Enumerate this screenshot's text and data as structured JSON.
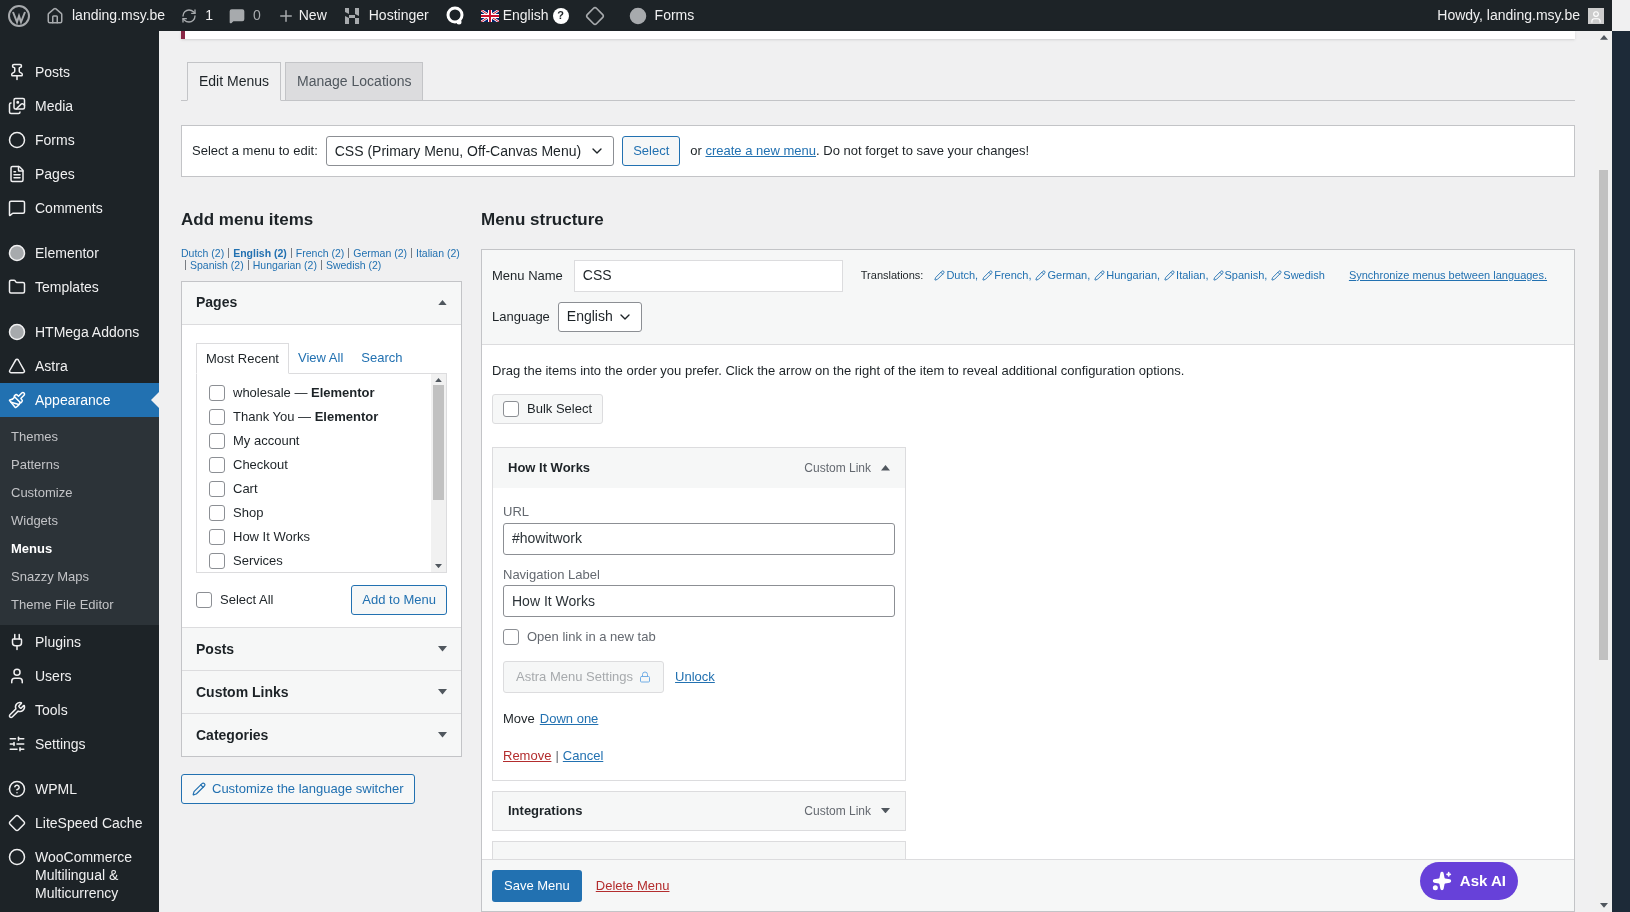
{
  "admin_bar": {
    "site": "landing.msy.be",
    "updates": "1",
    "comments": "0",
    "new": "New",
    "hostinger": "Hostinger",
    "language": "English",
    "language_help": "?",
    "forms": "Forms",
    "howdy": "Howdy, landing.msy.be"
  },
  "sidebar": {
    "items": [
      {
        "kind": "item",
        "label": "Posts",
        "selected": false
      },
      {
        "kind": "item",
        "label": "Media",
        "selected": false
      },
      {
        "kind": "item",
        "label": "Forms",
        "selected": false
      },
      {
        "kind": "item",
        "label": "Pages",
        "selected": false
      },
      {
        "kind": "item",
        "label": "Comments",
        "selected": false
      },
      {
        "kind": "separator"
      },
      {
        "kind": "item",
        "label": "Elementor",
        "selected": false
      },
      {
        "kind": "item",
        "label": "Templates",
        "selected": false
      },
      {
        "kind": "separator"
      },
      {
        "kind": "item",
        "label": "HTMega Addons",
        "selected": false
      },
      {
        "kind": "item",
        "label": "Astra",
        "selected": false
      },
      {
        "kind": "item",
        "label": "Appearance",
        "selected": true,
        "children": [
          {
            "label": "Themes",
            "selected": false
          },
          {
            "label": "Patterns",
            "selected": false
          },
          {
            "label": "Customize",
            "selected": false
          },
          {
            "label": "Widgets",
            "selected": false
          },
          {
            "label": "Menus",
            "selected": true
          },
          {
            "label": "Snazzy Maps",
            "selected": false
          },
          {
            "label": "Theme File Editor",
            "selected": false
          }
        ]
      },
      {
        "kind": "item",
        "label": "Plugins",
        "selected": false
      },
      {
        "kind": "item",
        "label": "Users",
        "selected": false
      },
      {
        "kind": "item",
        "label": "Tools",
        "selected": false
      },
      {
        "kind": "item",
        "label": "Settings",
        "selected": false
      },
      {
        "kind": "separator"
      },
      {
        "kind": "item",
        "label": "WPML",
        "selected": false
      },
      {
        "kind": "item",
        "label": "LiteSpeed Cache",
        "selected": false
      },
      {
        "kind": "item",
        "label": "WooCommerce Multilingual & Multicurrency",
        "selected": false
      }
    ]
  },
  "tabs": [
    {
      "label": "Edit Menus",
      "selected": true
    },
    {
      "label": "Manage Locations",
      "selected": false
    }
  ],
  "menu_select": {
    "label": "Select a menu to edit:",
    "value": "CSS (Primary Menu, Off-Canvas Menu)",
    "button": "Select",
    "text_before": "or",
    "link": "create a new menu",
    "text_after": ". Do not forget to save your changes!"
  },
  "add_menu_items": {
    "title": "Add menu items",
    "languages": [
      {
        "label": "Dutch (2)",
        "selected": false
      },
      {
        "label": "English (2)",
        "selected": true
      },
      {
        "label": "French (2)",
        "selected": false
      },
      {
        "label": "German (2)",
        "selected": false
      },
      {
        "label": "Italian (2)",
        "selected": false
      },
      {
        "label": "Spanish (2)",
        "selected": false
      },
      {
        "label": "Hungarian (2)",
        "selected": false
      },
      {
        "label": "Swedish (2)",
        "selected": false
      }
    ],
    "panels": [
      {
        "title": "Pages",
        "expanded": true,
        "tabs": [
          {
            "label": "Most Recent",
            "selected": true
          },
          {
            "label": "View All",
            "selected": false
          },
          {
            "label": "Search",
            "selected": false
          }
        ],
        "items": [
          {
            "label": "wholesale — **Elementor**",
            "checked": false
          },
          {
            "label": "Thank You — **Elementor**",
            "checked": false
          },
          {
            "label": "My account",
            "checked": false
          },
          {
            "label": "Checkout",
            "checked": false
          },
          {
            "label": "Cart",
            "checked": false
          },
          {
            "label": "Shop",
            "checked": false
          },
          {
            "label": "How It Works",
            "checked": false
          },
          {
            "label": "Services",
            "checked": false
          }
        ],
        "select_all": "Select All",
        "select_all_checked": false,
        "button": "Add to Menu"
      },
      {
        "title": "Posts",
        "expanded": false
      },
      {
        "title": "Custom Links",
        "expanded": false
      },
      {
        "title": "Categories",
        "expanded": false
      }
    ],
    "switcher_button": "Customize the language switcher"
  },
  "menu_structure": {
    "title": "Menu structure",
    "name_label": "Menu Name",
    "name_value": "CSS",
    "translations_label": "Translations:",
    "translations": [
      "Dutch,",
      "French,",
      "German,",
      "Hungarian,",
      "Italian,",
      "Spanish,",
      "Swedish"
    ],
    "sync_link": "Synchronize menus between languages.",
    "language_label": "Language",
    "language_value": "English",
    "instructions": "Drag the items into the order you prefer. Click the arrow on the right of the item to reveal additional configuration options.",
    "bulk_select": "Bulk Select",
    "bulk_checked": false,
    "items": [
      {
        "title": "How It Works",
        "type": "Custom Link",
        "expanded": true,
        "url_label": "URL",
        "url": "#howitwork",
        "nav_label": "Navigation Label",
        "nav_value": "How It Works",
        "new_tab_label": "Open link in a new tab",
        "new_tab": false,
        "astra_button": "Astra Menu Settings",
        "unlock": "Unlock",
        "move_label": "Move",
        "move_link": "Down one",
        "remove": "Remove",
        "separator": "|",
        "cancel": "Cancel"
      },
      {
        "title": "Integrations",
        "type": "Custom Link",
        "expanded": false
      },
      {
        "expanded": false
      }
    ],
    "save": "Save Menu",
    "delete": "Delete Menu"
  },
  "ask_ai": "Ask AI"
}
